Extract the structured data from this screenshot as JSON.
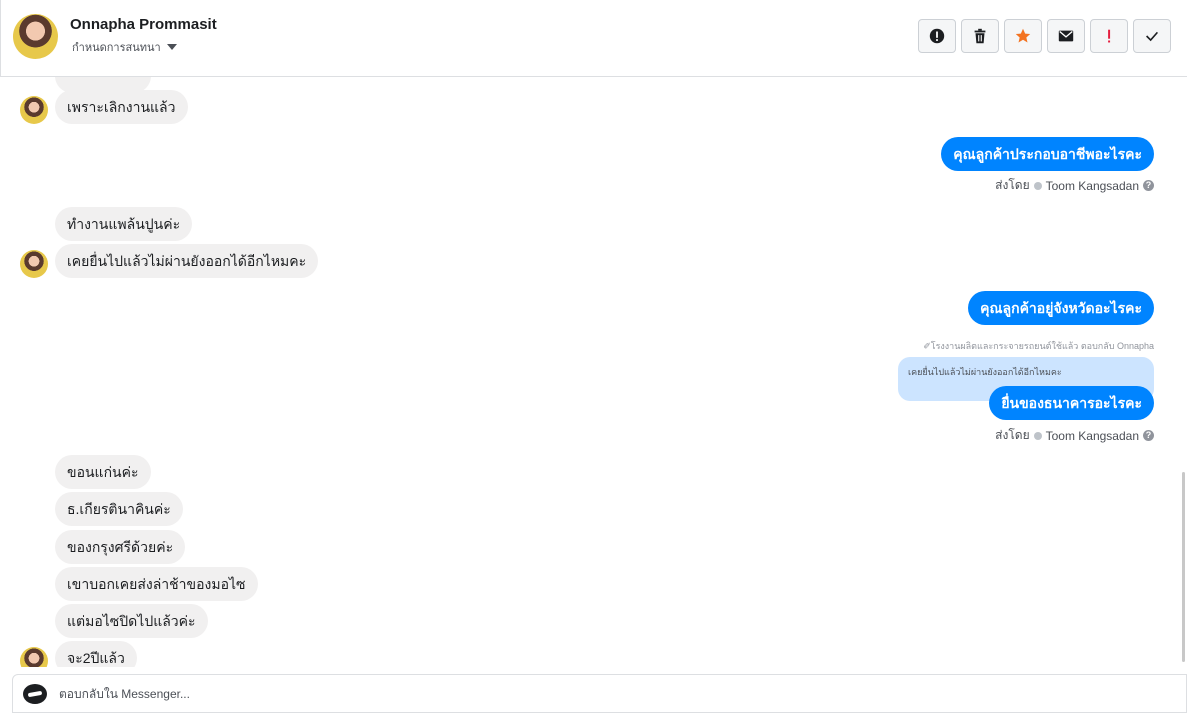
{
  "header": {
    "contact_name": "Onnapha Prommasit",
    "conversation_label": "กำหนดการสนทนา"
  },
  "toolbar": {
    "icons": [
      "alert-circle-icon",
      "trash-icon",
      "star-icon",
      "envelope-icon",
      "exclamation-icon",
      "check-icon"
    ],
    "colors": {
      "star": "#f37321",
      "exclamation": "#e41e3f",
      "default": "#1c1e21"
    }
  },
  "messages": {
    "in_1": "เพราะเลิกงานแล้ว",
    "out_1": "คุณลูกค้าประกอบอาชีพอะไรคะ",
    "in_2": "ทำงานแพล้นปูนค่ะ",
    "in_3": "เคยยื่นไปแล้วไม่ผ่านยังออกได้อีกไหมคะ",
    "out_2": "คุณลูกค้าอยู่จังหวัดอะไรคะ",
    "reply_note": "✐โรงงานผลิตและกระจายรถยนต์ใช้แล้ว ตอบกลับ Onnapha",
    "quoted": "เคยยื่นไปแล้วไม่ผ่านยังออกได้อีกไหมคะ",
    "out_3": "ยื่นของธนาคารอะไรคะ",
    "in_4": "ขอนแก่นค่ะ",
    "in_5": "ธ.เกียรตินาคินค่ะ",
    "in_6": "ของกรุงศรีด้วยค่ะ",
    "in_7": "เขาบอกเคยส่งล่าช้าของมอไซ",
    "in_8": "แต่มอไซปิดไปแล้วค่ะ",
    "in_9": "จะ2ปีแล้ว"
  },
  "sent_by": {
    "prefix": "ส่งโดย",
    "agent": "Toom Kangsadan"
  },
  "composer": {
    "placeholder": "ตอบกลับใน Messenger..."
  },
  "colors": {
    "outgoing_bubble": "#0084ff",
    "incoming_bubble": "#f1f0f0",
    "quoted_bubble": "#cce4ff"
  }
}
